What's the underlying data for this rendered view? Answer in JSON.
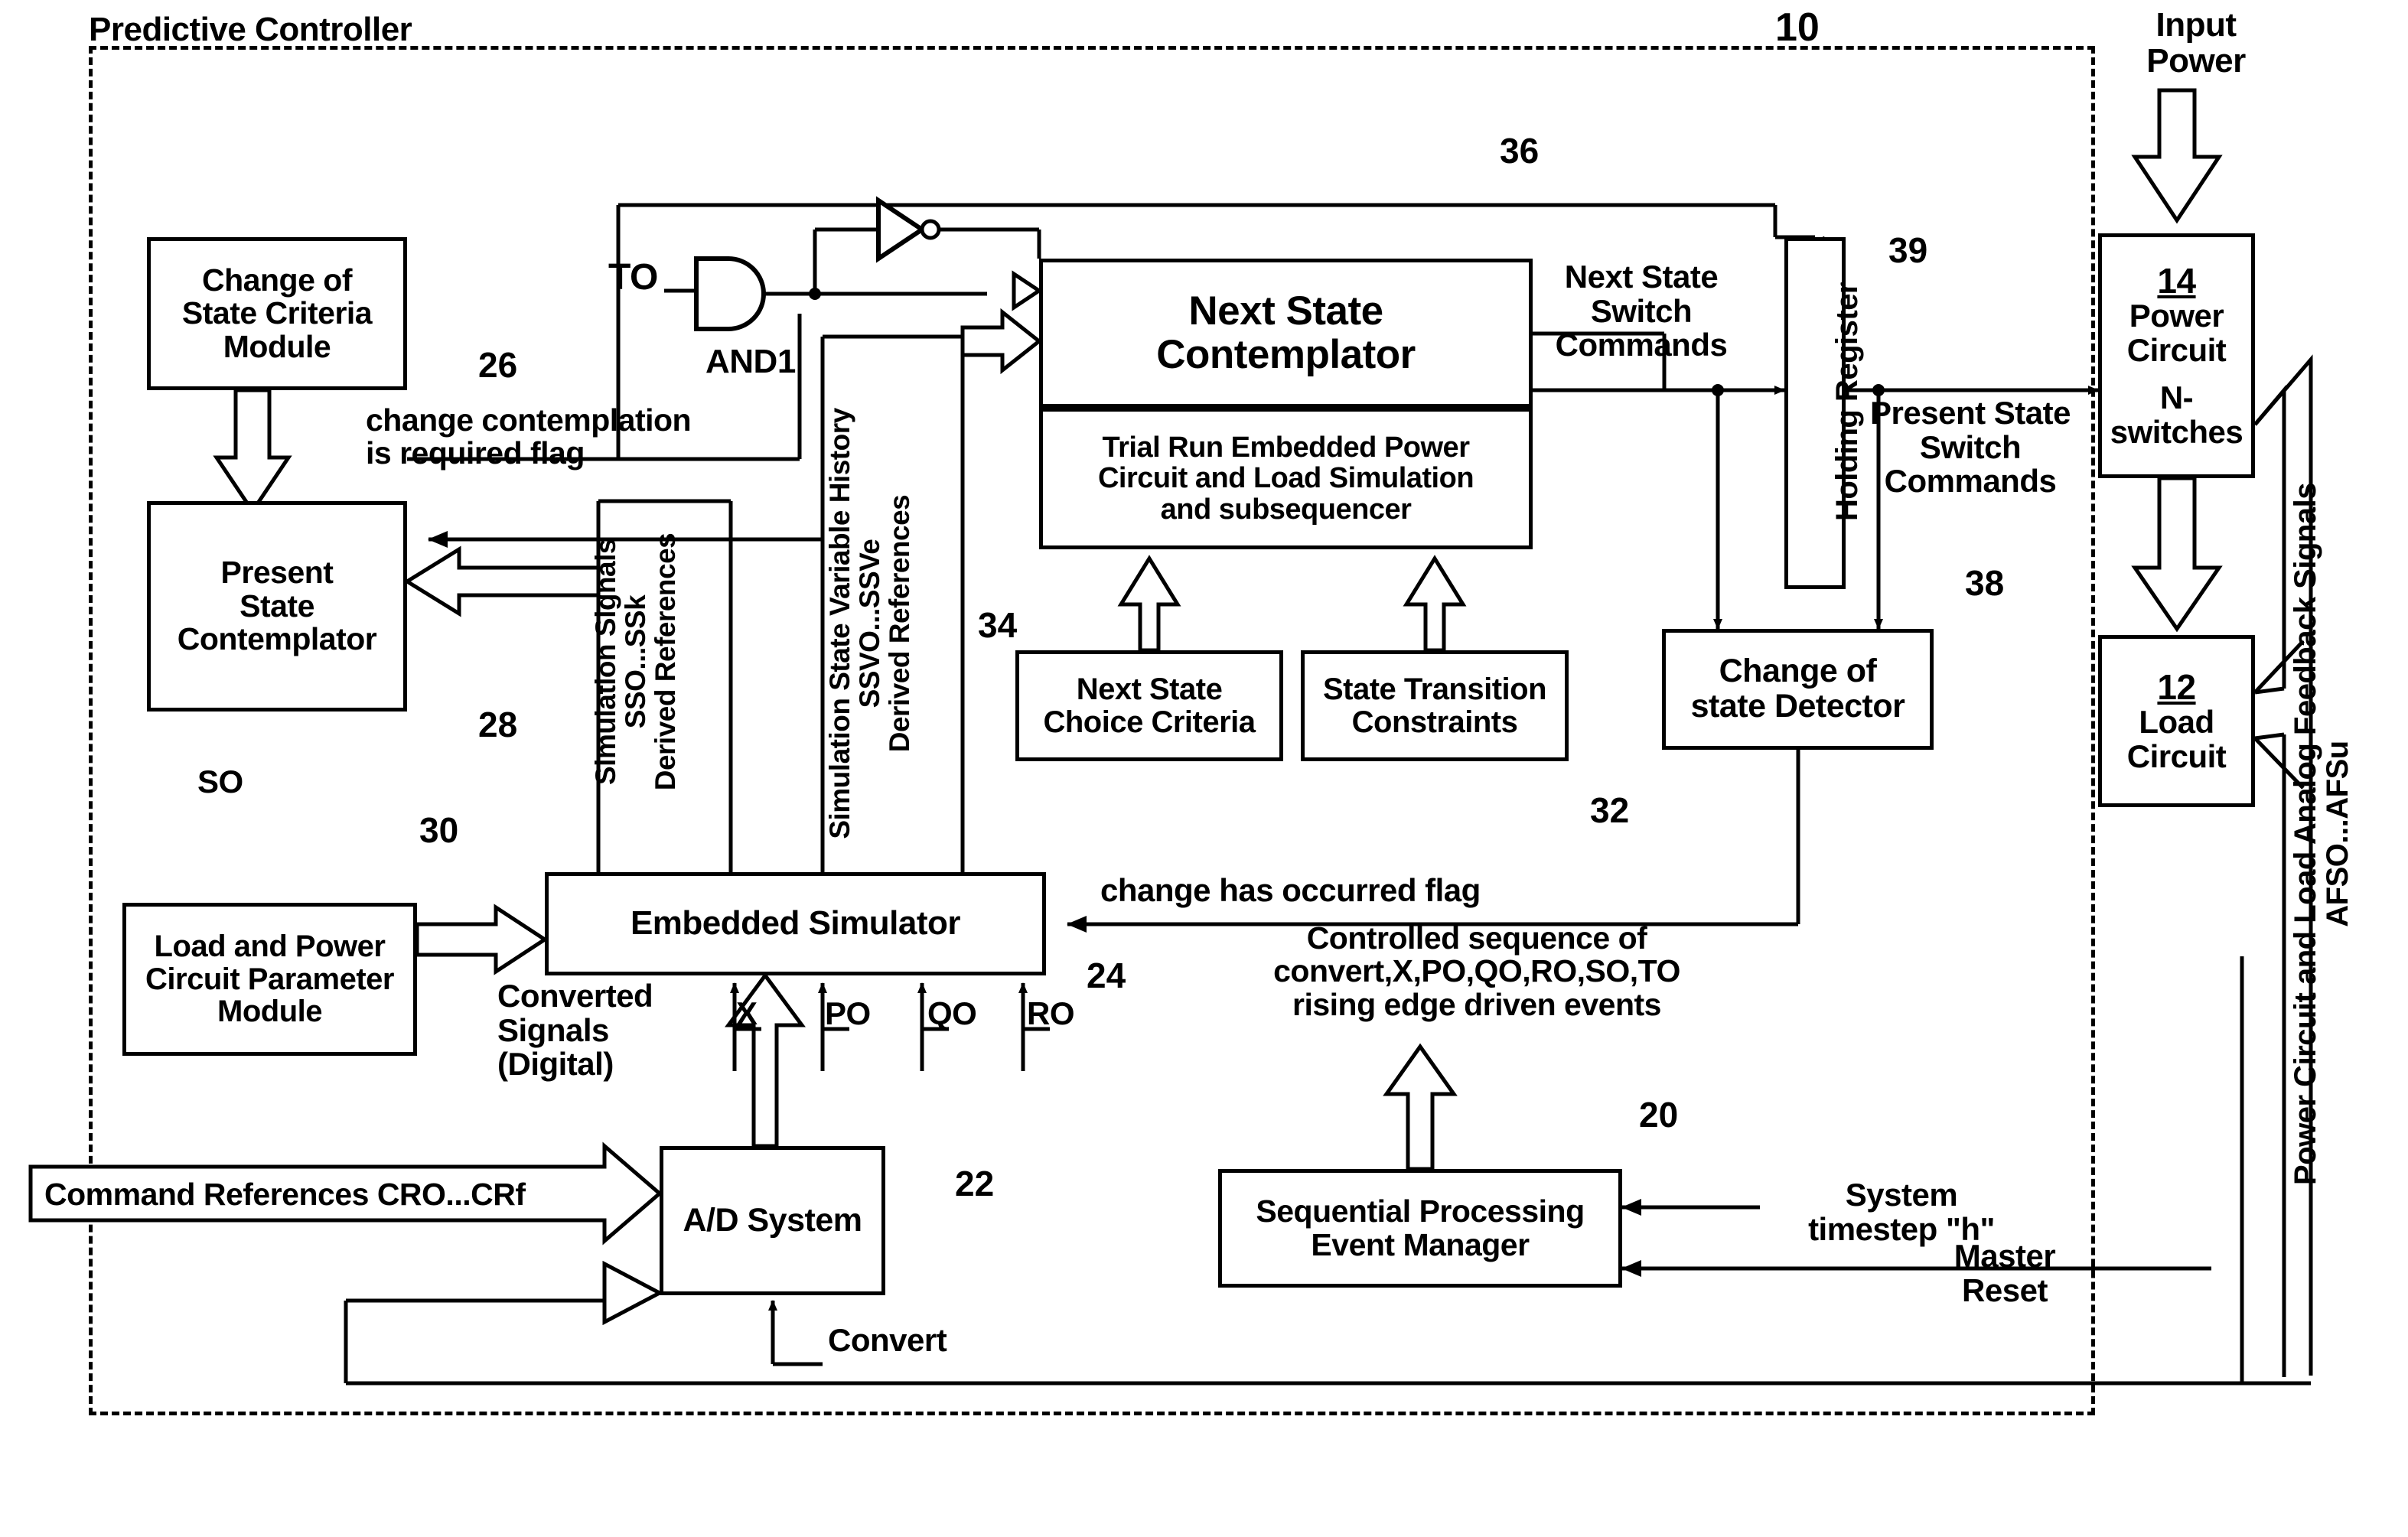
{
  "figure": {
    "title": "Predictive Controller",
    "figure_ref": "10"
  },
  "boundary": {
    "label": "Predictive Controller"
  },
  "blocks": {
    "change_of_state_criteria_module": {
      "label": "Change of\nState Criteria\nModule",
      "ref": "26"
    },
    "present_state_contemplator": {
      "label": "Present\nState\nContemplator",
      "ref": "28"
    },
    "load_power_param_module": {
      "label": "Load and Power\nCircuit Parameter\nModule",
      "ref": "30"
    },
    "next_state_contemplator": {
      "label": "Next State\nContemplator",
      "ref": "36"
    },
    "trial_run": {
      "label": "Trial Run Embedded Power\nCircuit and Load Simulation\nand subsequencer"
    },
    "next_state_choice_criteria": {
      "label": "Next State\nChoice Criteria",
      "ref": "34"
    },
    "state_transition_constraints": {
      "label": "State Transition\nConstraints",
      "ref": "32"
    },
    "holding_register": {
      "label": "Holding Register",
      "ref": "39"
    },
    "change_of_state_detector": {
      "label": "Change of\nstate Detector",
      "ref": "38"
    },
    "embedded_simulator": {
      "label": "Embedded Simulator",
      "ref": "24"
    },
    "ad_system": {
      "label": "A/D System",
      "ref": "22"
    },
    "sequential_processing_event_manager": {
      "label": "Sequential Processing\nEvent Manager",
      "ref": "20"
    },
    "power_circuit": {
      "num": "14",
      "label": "Power\nCircuit",
      "sub": "N-\nswitches"
    },
    "load_circuit": {
      "num": "12",
      "label": "Load\nCircuit"
    }
  },
  "signals": {
    "t0": "TO",
    "and1": "AND1",
    "s0": "SO",
    "change_contemplation_flag": "change contemplation\nis required flag",
    "change_has_occurred_flag": "change has occurred flag",
    "next_state_switch_commands": "Next State\nSwitch\nCommands",
    "present_state_switch_commands": "Present State\nSwitch\nCommands",
    "simulation_signals": "Simulation Signals\nSSO...SSk\nDerived References",
    "simulation_state_variable_history": "Simulation State Variable History\nSSVO...SSVe\nDerived References",
    "converted_signals": "Converted\nSignals\n(Digital)",
    "controlled_sequence": "Controlled sequence of\nconvert,X,PO,QO,RO,SO,TO\nrising edge driven events",
    "command_references": "Command References CRO...CRf",
    "convert": "Convert",
    "system_timestep": "System\ntimestep \"h\"",
    "master_reset": "Master\nReset",
    "input_power": "Input\nPower",
    "feedback_signals": "Power Circuit and Load Analog Feedback Signals\nAFSO...AFSu",
    "sim_inputs": [
      "X",
      "PO",
      "QO",
      "RO"
    ]
  },
  "refs": {
    "r10": "10",
    "r12": "12",
    "r14": "14",
    "r20": "20",
    "r22": "22",
    "r24": "24",
    "r26": "26",
    "r28": "28",
    "r30": "30",
    "r32": "32",
    "r34": "34",
    "r36": "36",
    "r38": "38",
    "r39": "39"
  },
  "colors": {
    "ink": "#000000",
    "paper": "#ffffff"
  }
}
